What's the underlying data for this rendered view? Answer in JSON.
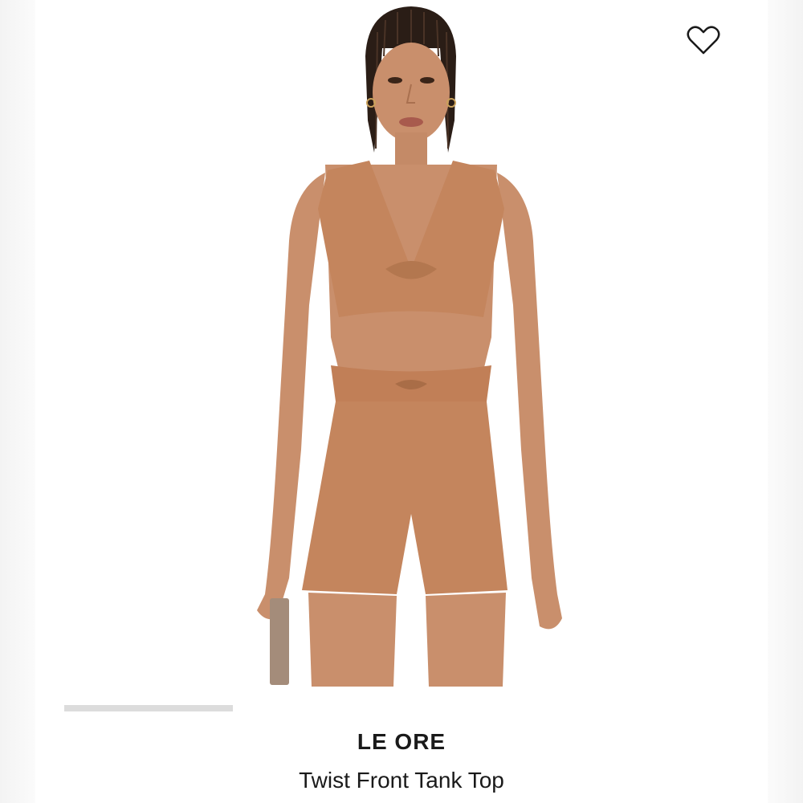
{
  "product": {
    "brand": "LE ORE",
    "name": "Twist Front Tank Top",
    "image_alt": "Model wearing tan twist front tank top and matching bike shorts"
  },
  "icons": {
    "favorite": "heart-outline-icon"
  },
  "colors": {
    "garment": "#c4855d",
    "skin": "#c98f6c",
    "text": "#1a1a1a"
  }
}
